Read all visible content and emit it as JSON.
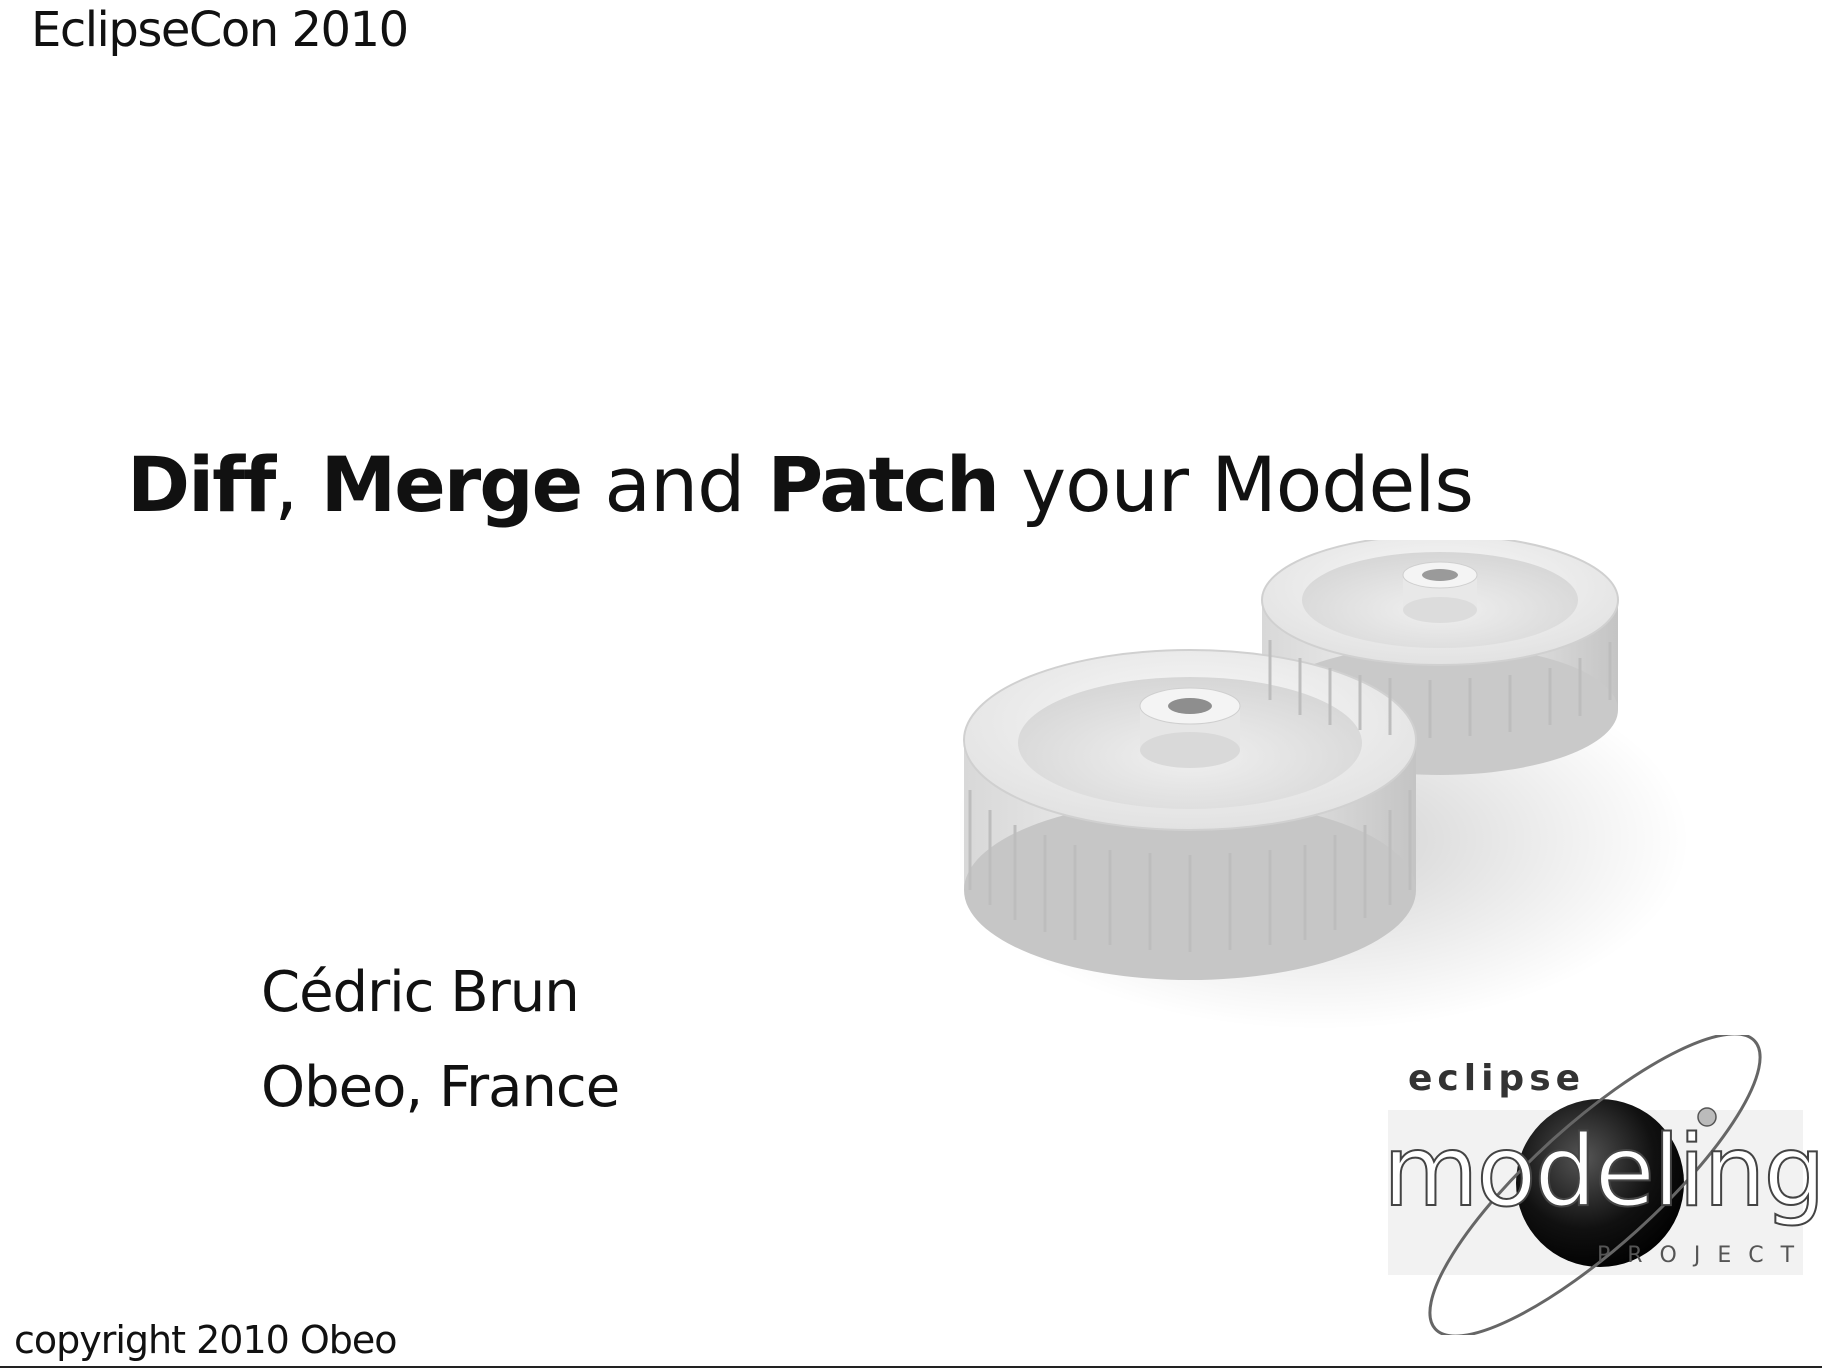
{
  "slide": {
    "conference": "EclipseCon 2010",
    "title": {
      "part1": "Diff",
      "sep1": ",",
      "part2": "Merge",
      "sep2": "and",
      "part3": "Patch",
      "sep3": "your Models"
    },
    "author": "Cédric Brun",
    "organization": "Obeo, France",
    "copyright": "copyright 2010 Obeo"
  },
  "logo": {
    "top_text": "eclipse",
    "main_text": "modeling",
    "bottom_text": "PROJECT"
  },
  "images": {
    "gears": "gears-illustration",
    "logo": "eclipse-modeling-logo"
  }
}
